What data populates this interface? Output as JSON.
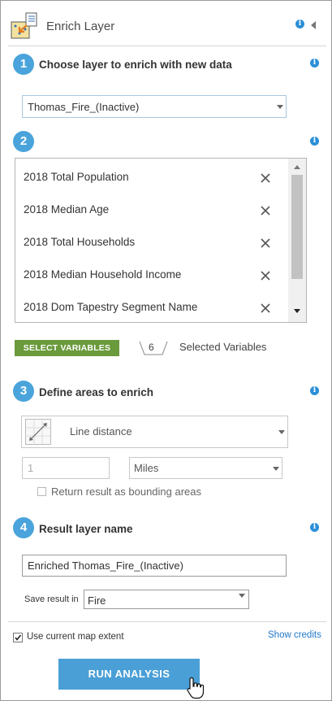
{
  "header": {
    "title": "Enrich Layer",
    "icon": "enrich-layer-icon"
  },
  "steps": [
    {
      "number": "1",
      "title": "Choose layer to enrich with new data"
    },
    {
      "number": "2",
      "title": ""
    },
    {
      "number": "3",
      "title": "Define areas to enrich"
    },
    {
      "number": "4",
      "title": "Result layer name"
    }
  ],
  "layer_select": {
    "value": "Thomas_Fire_(Inactive)"
  },
  "variables": {
    "items": [
      "2018 Total Population",
      "2018 Median Age",
      "2018 Total Households",
      "2018 Median Household Income",
      "2018 Dom Tapestry Segment Name"
    ],
    "select_button": "SELECT VARIABLES",
    "count": "6",
    "selected_label": "Selected Variables"
  },
  "areas": {
    "type": "Line distance",
    "distance_placeholder": "1",
    "units": "Miles",
    "bounding_label": "Return result as bounding areas"
  },
  "result": {
    "layer_name": "Enriched Thomas_Fire_(Inactive)",
    "save_label": "Save result in",
    "save_folder": "Fire"
  },
  "footer": {
    "use_extent_label": "Use current map extent",
    "use_extent_checked": true,
    "show_credits": "Show credits",
    "run_button": "RUN ANALYSIS"
  },
  "colors": {
    "accent": "#4aa4db",
    "button_green": "#6a9a3c",
    "run_blue": "#4a9fd6",
    "link": "#1f78c8"
  }
}
